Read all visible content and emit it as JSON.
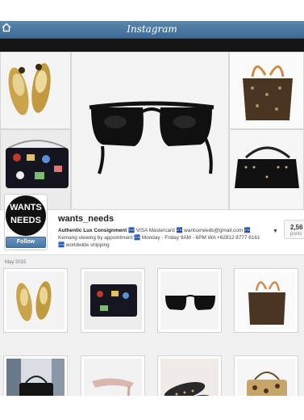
{
  "navbar": {
    "title": "Instagram",
    "back_icon": "home-icon"
  },
  "profile": {
    "username": "wants_needs",
    "avatar_line1": "WANTS",
    "avatar_line2": "NEEDS",
    "follow_label": "Follow",
    "bio_line1_bold": "Authentic Lux Consignment",
    "bio_rest": " 🏧 VISA Mastercard 🏧 wantsxneeds@gmail.com 🏧 Kemang viewing by appointment 🏧 Monday - Friday 9AM - 6PM WA +62812 8777 6161 🏧 worldwide shipping",
    "posts_count": "2,56",
    "posts_label": "posts"
  },
  "grid": {
    "month_label": "May 2015"
  },
  "colors": {
    "navbar": "#4a76a0",
    "follow_button": "#5785b2"
  }
}
